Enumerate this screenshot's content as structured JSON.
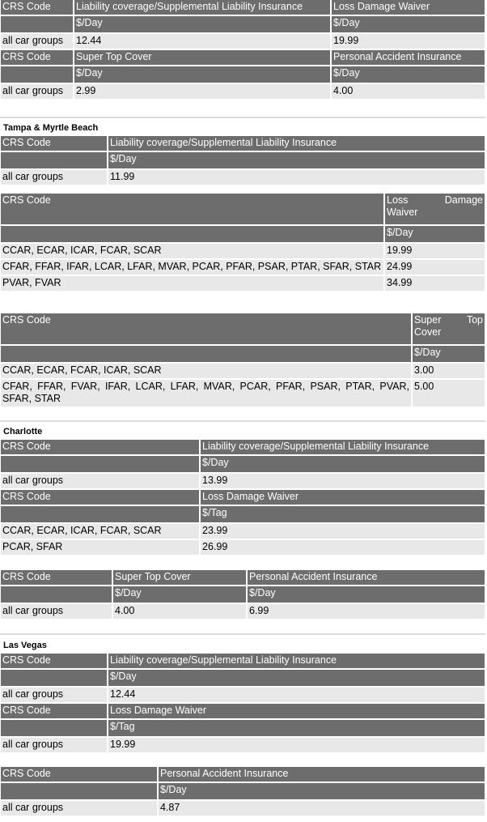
{
  "block1": {
    "t1": {
      "crs": "CRS Code",
      "c1": "Liability coverage/Supplemental Liability Insurance",
      "c2": "Loss Damage Waiver",
      "u1": "$/Day",
      "u2": "$/Day",
      "row": "all car groups",
      "v1": "12.44",
      "v2": "19.99"
    },
    "t2": {
      "crs": "CRS Code",
      "c1": "Super Top Cover",
      "c2": "Personal Accident Insurance",
      "u1": "$/Day",
      "u2": "$/Day",
      "row": "all car groups",
      "v1": "2.99",
      "v2": "4.00"
    }
  },
  "tampa": {
    "title": "Tampa & Myrtle Beach",
    "liab": {
      "crs": "CRS Code",
      "c1": "Liability coverage/Supplemental Liability Insurance",
      "u1": "$/Day",
      "row": "all car groups",
      "v1": "11.99"
    },
    "ldw": {
      "crs": "CRS Code",
      "c1": "Loss Damage Waiver",
      "u1": "$/Day",
      "rows": [
        {
          "codes": "CCAR, ECAR, ICAR, FCAR, SCAR",
          "v": "19.99"
        },
        {
          "codes": "CFAR, FFAR, IFAR, LCAR, LFAR, MVAR, PCAR, PFAR, PSAR, PTAR, SFAR, STAR",
          "v": "24.99"
        },
        {
          "codes": "PVAR, FVAR",
          "v": "34.99"
        }
      ]
    },
    "stc": {
      "crs": "CRS Code",
      "c1": "Super Top Cover",
      "u1": "$/Day",
      "rows": [
        {
          "codes": "CCAR, ECAR, FCAR, ICAR, SCAR",
          "v": "3.00"
        },
        {
          "codes": "CFAR, FFAR, FVAR, IFAR, LCAR, LFAR, MVAR, PCAR, PFAR, PSAR, PTAR, PVAR, SFAR, STAR",
          "v": "5.00"
        }
      ]
    }
  },
  "charlotte": {
    "title": "Charlotte",
    "liab": {
      "crs": "CRS Code",
      "c1": "Liability coverage/Supplemental Liability Insurance",
      "u1": "$/Day",
      "row": "all car groups",
      "v1": "13.99"
    },
    "ldw": {
      "crs": "CRS Code",
      "c1": "Loss Damage Waiver",
      "u1": "$/Tag",
      "rows": [
        {
          "codes": "CCAR, ECAR, ICAR, FCAR, SCAR",
          "v": "23.99"
        },
        {
          "codes": "PCAR, SFAR",
          "v": "26.99"
        }
      ]
    },
    "t3": {
      "crs": "CRS Code",
      "c1": "Super Top Cover",
      "c2": "Personal Accident Insurance",
      "u1": "$/Day",
      "u2": "$/Day",
      "row": "all car groups",
      "v1": "4.00",
      "v2": "6.99"
    }
  },
  "vegas": {
    "title": "Las Vegas",
    "liab": {
      "crs": "CRS Code",
      "c1": "Liability coverage/Supplemental Liability Insurance",
      "u1": "$/Day",
      "row": "all car groups",
      "v1": "12.44"
    },
    "ldw": {
      "crs": "CRS Code",
      "c1": "Loss Damage Waiver",
      "u1": "$/Tag",
      "row": "all car groups",
      "v1": "19.99"
    },
    "pai": {
      "crs": "CRS Code",
      "c1": "Personal Accident Insurance",
      "u1": "$/Day",
      "row": "all car groups",
      "v1": "4.87"
    }
  }
}
